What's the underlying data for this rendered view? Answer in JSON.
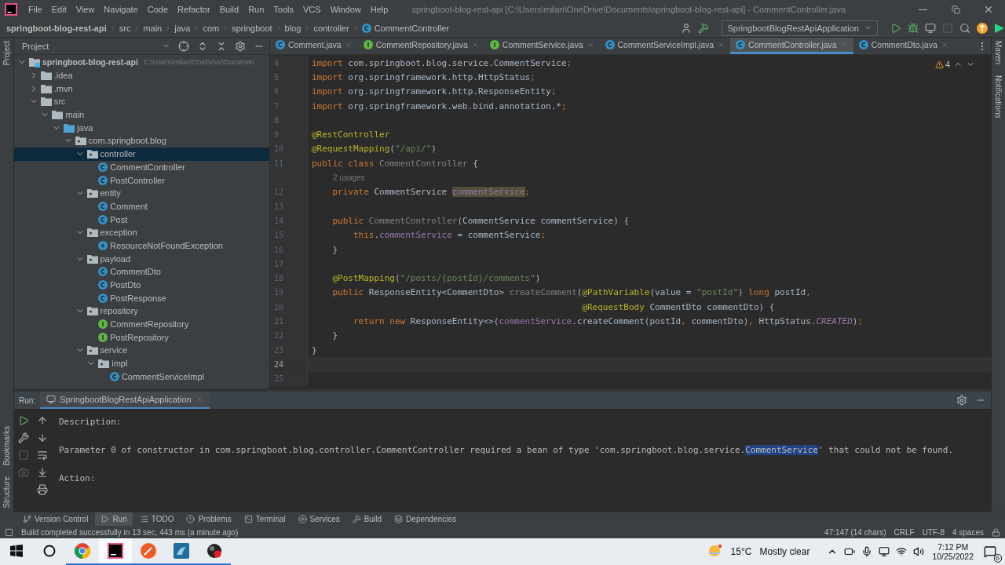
{
  "window": {
    "title": "springboot-blog-rest-api [C:\\Users\\milan\\OneDrive\\Documents\\springboot-blog-rest-api] - CommentController.java"
  },
  "menu": [
    "File",
    "Edit",
    "View",
    "Navigate",
    "Code",
    "Refactor",
    "Build",
    "Run",
    "Tools",
    "VCS",
    "Window",
    "Help"
  ],
  "breadcrumbs": [
    "springboot-blog-rest-api",
    "src",
    "main",
    "java",
    "com",
    "springboot",
    "blog",
    "controller",
    "CommentController"
  ],
  "toolbar": {
    "run_configuration": "SpringbootBlogRestApiApplication"
  },
  "side_stripes": {
    "left_top": [
      "Project"
    ],
    "left_bottom": [
      "Bookmarks",
      "Structure"
    ],
    "right": [
      "Maven",
      "Notifications"
    ]
  },
  "project_panel": {
    "title": "Project",
    "tree": [
      {
        "label": "springboot-blog-rest-api",
        "path": "C:\\Users\\milan\\OneDrive\\Documen",
        "kind": "module",
        "expanded": true,
        "selected": false,
        "children": [
          {
            "label": ".idea",
            "kind": "folder",
            "expanded": false,
            "selected": false
          },
          {
            "label": ".mvn",
            "kind": "folder",
            "expanded": false,
            "selected": false
          },
          {
            "label": "src",
            "kind": "folder",
            "expanded": true,
            "selected": false,
            "children": [
              {
                "label": "main",
                "kind": "folder",
                "expanded": true,
                "selected": false,
                "children": [
                  {
                    "label": "java",
                    "kind": "source",
                    "expanded": true,
                    "selected": false,
                    "children": [
                      {
                        "label": "com.springboot.blog",
                        "kind": "package",
                        "expanded": true,
                        "selected": false,
                        "children": [
                          {
                            "label": "controller",
                            "kind": "package",
                            "expanded": true,
                            "selected": true,
                            "children": [
                              {
                                "label": "CommentController",
                                "kind": "class",
                                "selected": false
                              },
                              {
                                "label": "PostController",
                                "kind": "class",
                                "selected": false
                              }
                            ]
                          },
                          {
                            "label": "entity",
                            "kind": "package",
                            "expanded": true,
                            "selected": false,
                            "children": [
                              {
                                "label": "Comment",
                                "kind": "class",
                                "selected": false
                              },
                              {
                                "label": "Post",
                                "kind": "class",
                                "selected": false
                              }
                            ]
                          },
                          {
                            "label": "exception",
                            "kind": "package",
                            "expanded": true,
                            "selected": false,
                            "children": [
                              {
                                "label": "ResourceNotFoundException",
                                "kind": "exception",
                                "selected": false
                              }
                            ]
                          },
                          {
                            "label": "payload",
                            "kind": "package",
                            "expanded": true,
                            "selected": false,
                            "children": [
                              {
                                "label": "CommentDto",
                                "kind": "class",
                                "selected": false
                              },
                              {
                                "label": "PostDto",
                                "kind": "class",
                                "selected": false
                              },
                              {
                                "label": "PostResponse",
                                "kind": "class",
                                "selected": false
                              }
                            ]
                          },
                          {
                            "label": "repository",
                            "kind": "package",
                            "expanded": true,
                            "selected": false,
                            "children": [
                              {
                                "label": "CommentRepository",
                                "kind": "interface",
                                "selected": false
                              },
                              {
                                "label": "PostRepository",
                                "kind": "interface",
                                "selected": false
                              }
                            ]
                          },
                          {
                            "label": "service",
                            "kind": "package",
                            "expanded": true,
                            "selected": false,
                            "children": [
                              {
                                "label": "impl",
                                "kind": "package",
                                "expanded": true,
                                "selected": false,
                                "children": [
                                  {
                                    "label": "CommentServiceImpl",
                                    "kind": "class",
                                    "selected": false
                                  }
                                ]
                              }
                            ]
                          }
                        ]
                      }
                    ]
                  }
                ]
              }
            ]
          }
        ]
      }
    ]
  },
  "editor": {
    "tabs": [
      {
        "label": "Comment.java",
        "kind": "class",
        "selected": false
      },
      {
        "label": "CommentRepository.java",
        "kind": "interface",
        "selected": false
      },
      {
        "label": "CommentService.java",
        "kind": "interface",
        "selected": false
      },
      {
        "label": "CommentServiceImpl.java",
        "kind": "class",
        "selected": false
      },
      {
        "label": "CommentController.java",
        "kind": "class",
        "selected": true
      },
      {
        "label": "CommentDto.java",
        "kind": "class",
        "selected": false
      }
    ],
    "warnings": "4",
    "lines": [
      {
        "kind": "code",
        "number": "4",
        "current": false,
        "tokens": [
          {
            "kind": "kw",
            "text": "import"
          },
          {
            "kind": "plain",
            "text": " com.springboot.blog.service.CommentService"
          },
          {
            "kind": "punct",
            "text": ";"
          }
        ]
      },
      {
        "kind": "code",
        "number": "5",
        "current": false,
        "tokens": [
          {
            "kind": "kw",
            "text": "import"
          },
          {
            "kind": "plain",
            "text": " org.springframework.http.HttpStatus"
          },
          {
            "kind": "punct",
            "text": ";"
          }
        ]
      },
      {
        "kind": "code",
        "number": "6",
        "current": false,
        "tokens": [
          {
            "kind": "kw",
            "text": "import"
          },
          {
            "kind": "plain",
            "text": " org.springframework.http.ResponseEntity"
          },
          {
            "kind": "punct",
            "text": ";"
          }
        ]
      },
      {
        "kind": "code",
        "number": "7",
        "current": false,
        "tokens": [
          {
            "kind": "kw",
            "text": "import"
          },
          {
            "kind": "plain",
            "text": " org.springframework.web.bind.annotation.*"
          },
          {
            "kind": "punct",
            "text": ";"
          }
        ]
      },
      {
        "kind": "code",
        "number": "8",
        "current": false
      },
      {
        "kind": "code",
        "number": "9",
        "current": false,
        "tokens": [
          {
            "kind": "ann",
            "text": "@RestController"
          }
        ]
      },
      {
        "kind": "code",
        "number": "10",
        "current": false,
        "tokens": [
          {
            "kind": "ann",
            "text": "@RequestMapping"
          },
          {
            "kind": "plain",
            "text": "("
          },
          {
            "kind": "str",
            "text": "\"/api/\""
          },
          {
            "kind": "plain",
            "text": ")"
          }
        ]
      },
      {
        "kind": "code",
        "number": "11",
        "current": false,
        "tokens": [
          {
            "kind": "kw",
            "text": "public class"
          },
          {
            "kind": "unused",
            "text": " CommentController"
          },
          {
            "kind": "plain",
            "text": " {"
          }
        ]
      },
      {
        "kind": "hint",
        "text": "2 usages"
      },
      {
        "kind": "code",
        "number": "12",
        "current": false,
        "tokens": [
          {
            "kind": "kw",
            "text": "    private"
          },
          {
            "kind": "plain",
            "text": " CommentService "
          },
          {
            "kind": "hl",
            "text": "commentService"
          },
          {
            "kind": "punct",
            "text": ";"
          }
        ]
      },
      {
        "kind": "code",
        "number": "13",
        "current": false
      },
      {
        "kind": "code",
        "number": "14",
        "current": false,
        "tokens": [
          {
            "kind": "kw",
            "text": "    public"
          },
          {
            "kind": "unused",
            "text": " CommentController"
          },
          {
            "kind": "plain",
            "text": "(CommentService commentService) {"
          }
        ]
      },
      {
        "kind": "code",
        "number": "15",
        "current": false,
        "tokens": [
          {
            "kind": "kw",
            "text": "        this"
          },
          {
            "kind": "plain",
            "text": "."
          },
          {
            "kind": "field",
            "text": "commentService"
          },
          {
            "kind": "plain",
            "text": " = commentService"
          },
          {
            "kind": "punct",
            "text": ";"
          }
        ]
      },
      {
        "kind": "code",
        "number": "16",
        "current": false,
        "tokens": [
          {
            "kind": "plain",
            "text": "    }"
          }
        ]
      },
      {
        "kind": "code",
        "number": "17",
        "current": false
      },
      {
        "kind": "code",
        "number": "18",
        "current": false,
        "tokens": [
          {
            "kind": "ann",
            "text": "    @PostMapping"
          },
          {
            "kind": "plain",
            "text": "("
          },
          {
            "kind": "str",
            "text": "\"/posts/{postId}/comments\""
          },
          {
            "kind": "plain",
            "text": ")"
          }
        ]
      },
      {
        "kind": "code",
        "number": "19",
        "current": false,
        "tokens": [
          {
            "kind": "kw",
            "text": "    public"
          },
          {
            "kind": "plain",
            "text": " ResponseEntity<CommentDto> "
          },
          {
            "kind": "unused",
            "text": "createComment"
          },
          {
            "kind": "plain",
            "text": "("
          },
          {
            "kind": "ann",
            "text": "@PathVariable"
          },
          {
            "kind": "plain",
            "text": "(value = "
          },
          {
            "kind": "str",
            "text": "\"postId\""
          },
          {
            "kind": "plain",
            "text": ") "
          },
          {
            "kind": "kw",
            "text": "long"
          },
          {
            "kind": "plain",
            "text": " postId"
          },
          {
            "kind": "punct",
            "text": ","
          }
        ]
      },
      {
        "kind": "code",
        "number": "20",
        "current": false,
        "tokens": [
          {
            "kind": "ann",
            "text": "                                                    @RequestBody"
          },
          {
            "kind": "plain",
            "text": " CommentDto commentDto) {"
          }
        ]
      },
      {
        "kind": "code",
        "number": "21",
        "current": false,
        "tokens": [
          {
            "kind": "kw",
            "text": "        return new"
          },
          {
            "kind": "plain",
            "text": " ResponseEntity<>("
          },
          {
            "kind": "field",
            "text": "commentService"
          },
          {
            "kind": "plain",
            "text": ".createComment(postId"
          },
          {
            "kind": "punct",
            "text": ","
          },
          {
            "kind": "plain",
            "text": " commentDto)"
          },
          {
            "kind": "punct",
            "text": ","
          },
          {
            "kind": "plain",
            "text": " HttpStatus."
          },
          {
            "kind": "const",
            "text": "CREATED"
          },
          {
            "kind": "plain",
            "text": ")"
          },
          {
            "kind": "punct",
            "text": ";"
          }
        ]
      },
      {
        "kind": "code",
        "number": "22",
        "current": false,
        "tokens": [
          {
            "kind": "plain",
            "text": "    }"
          }
        ]
      },
      {
        "kind": "code",
        "number": "23",
        "current": false,
        "tokens": [
          {
            "kind": "plain",
            "text": "}"
          }
        ]
      },
      {
        "kind": "code",
        "number": "24",
        "current": true
      },
      {
        "kind": "code",
        "number": "25",
        "current": false
      }
    ]
  },
  "run_panel": {
    "label": "Run:",
    "tabs": [
      {
        "label": "SpringbootBlogRestApiApplication",
        "selected": true
      }
    ],
    "console": [
      {
        "segments": [
          {
            "text": "Description:",
            "selected": false
          }
        ]
      },
      {
        "segments": [
          {
            "text": "Parameter 0 of constructor in com.springboot.blog.controller.CommentController required a bean of type 'com.springboot.blog.service.",
            "selected": false
          },
          {
            "text": "CommentService",
            "selected": true
          },
          {
            "text": "' that could not be found.",
            "selected": false
          }
        ]
      },
      {
        "segments": [
          {
            "text": "Action:",
            "selected": false
          }
        ]
      }
    ]
  },
  "tool_windows": [
    {
      "label": "Version Control",
      "selected": false
    },
    {
      "label": "Run",
      "selected": true
    },
    {
      "label": "TODO",
      "selected": false
    },
    {
      "label": "Problems",
      "selected": false
    },
    {
      "label": "Terminal",
      "selected": false
    },
    {
      "label": "Services",
      "selected": false
    },
    {
      "label": "Build",
      "selected": false
    },
    {
      "label": "Dependencies",
      "selected": false
    }
  ],
  "status_bar": {
    "message": "Build completed successfully in 13 sec, 443 ms (a minute ago)",
    "position": "47:147 (14 chars)",
    "line_separator": "CRLF",
    "encoding": "UTF-8",
    "indent": "4 spaces"
  },
  "taskbar": {
    "apps": [
      {
        "kind": "start",
        "running": false,
        "selected": false
      },
      {
        "kind": "search",
        "running": false,
        "selected": false
      },
      {
        "kind": "chrome",
        "running": true,
        "selected": false
      },
      {
        "kind": "ide",
        "running": true,
        "selected": true
      },
      {
        "kind": "postman",
        "running": true,
        "selected": false
      },
      {
        "kind": "workbench",
        "running": true,
        "selected": false
      },
      {
        "kind": "obs",
        "running": true,
        "selected": false
      }
    ],
    "weather": {
      "temperature": "15°C",
      "condition": "Mostly clear"
    },
    "clock": {
      "time": "7:12 PM",
      "date": "10/25/2022"
    },
    "notifications": "6"
  }
}
